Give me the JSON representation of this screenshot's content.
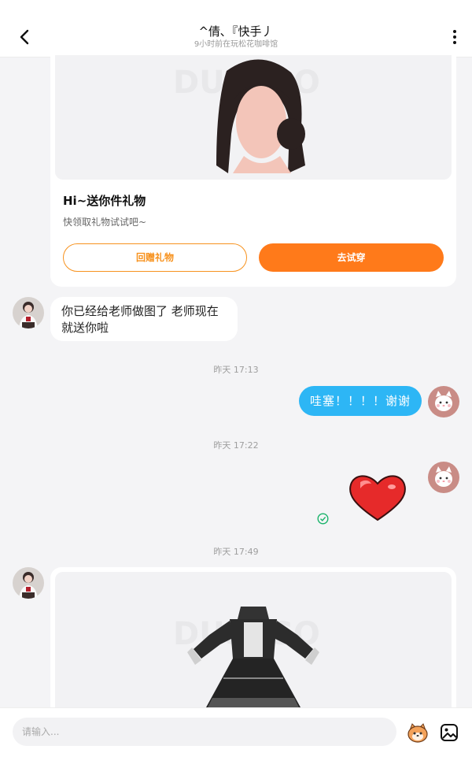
{
  "header": {
    "title": "^倩､『快手丿",
    "subtitle": "9小时前在玩松花咖啡馆",
    "back_icon": "chevron-left-icon",
    "more_icon": "more-vertical-icon"
  },
  "gift_card": {
    "title": "Hi~送你件礼物",
    "subtitle": "快领取礼物试试吧~",
    "return_gift_label": "回赠礼物",
    "try_on_label": "去试穿",
    "accent_color": "#ff7a1a"
  },
  "messages": {
    "incoming_text": "你已经给老师做图了 老师现在就送你啦",
    "time_1": "昨天 17:13",
    "outgoing_text": "哇塞！！！！谢谢",
    "time_2": "昨天 17:22",
    "sticker": "heart-sticker",
    "time_3": "昨天 17:49",
    "outgoing_color": "#2db6f5"
  },
  "input_bar": {
    "placeholder": "请输入...",
    "emoji_icon": "emoji-face-icon",
    "image_icon": "image-icon"
  }
}
